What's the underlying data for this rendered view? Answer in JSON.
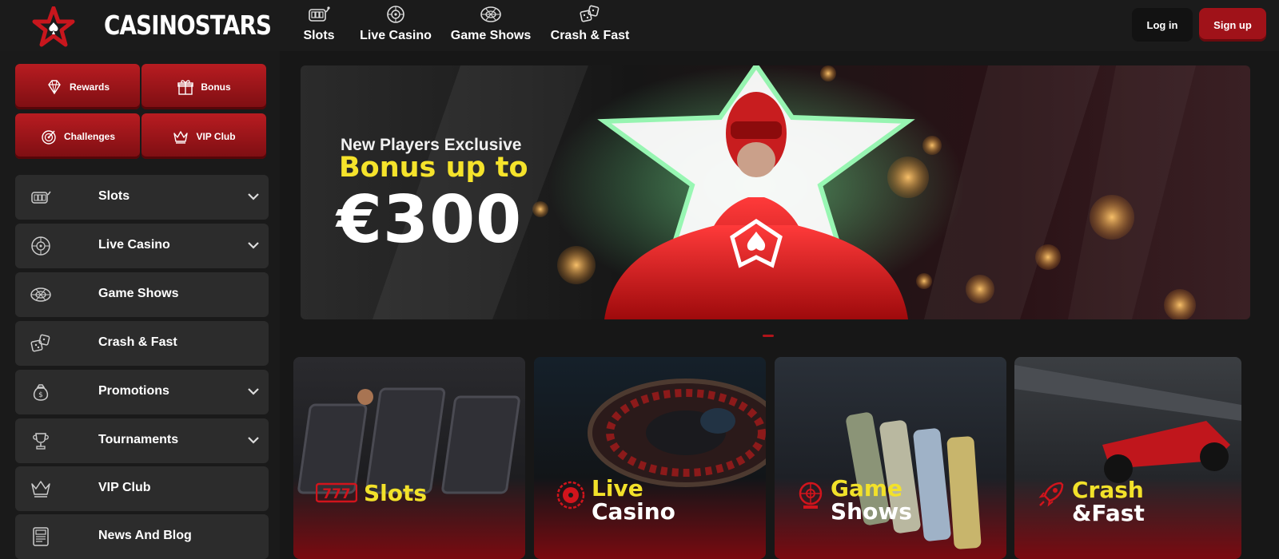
{
  "brand": {
    "name": "CASINOSTARS"
  },
  "topnav": [
    {
      "label": "Slots",
      "icon": "slot-machine-icon"
    },
    {
      "label": "Live Casino",
      "icon": "roulette-icon"
    },
    {
      "label": "Game Shows",
      "icon": "wheel-icon"
    },
    {
      "label": "Crash & Fast",
      "icon": "dice-icon"
    }
  ],
  "auth": {
    "login_label": "Log in",
    "signup_label": "Sign up"
  },
  "quick_links": [
    {
      "label": "Rewards",
      "icon": "diamond-icon"
    },
    {
      "label": "Bonus",
      "icon": "gift-icon"
    },
    {
      "label": "Challenges",
      "icon": "target-icon"
    },
    {
      "label": "VIP Club",
      "icon": "crown-icon"
    }
  ],
  "sidebar": {
    "items": [
      {
        "label": "Slots",
        "icon": "slot-machine-icon",
        "expandable": true
      },
      {
        "label": "Live Casino",
        "icon": "roulette-icon",
        "expandable": true
      },
      {
        "label": "Game Shows",
        "icon": "wheel-icon",
        "expandable": false
      },
      {
        "label": "Crash & Fast",
        "icon": "dice-icon",
        "expandable": false
      },
      {
        "label": "Promotions",
        "icon": "money-bag-icon",
        "expandable": true
      },
      {
        "label": "Tournaments",
        "icon": "trophy-icon",
        "expandable": true
      },
      {
        "label": "VIP Club",
        "icon": "crown-icon",
        "expandable": false
      },
      {
        "label": "News And Blog",
        "icon": "news-icon",
        "expandable": false
      }
    ]
  },
  "banner": {
    "line1": "New Players Exclusive",
    "line2": "Bonus up to",
    "amount": "€300"
  },
  "categories": [
    {
      "icon": "777-icon",
      "title": "Slots"
    },
    {
      "icon": "roulette-icon",
      "title_yellow": "Live",
      "title_white": "Casino"
    },
    {
      "icon": "wheel-icon",
      "title_yellow": "Game",
      "title_white": "Shows"
    },
    {
      "icon": "rocket-icon",
      "title_yellow": "Crash",
      "title_white": "&Fast"
    }
  ],
  "colors": {
    "accent_red": "#a01219",
    "highlight_yellow": "#f2e12a",
    "background": "#171717",
    "panel": "#2c2c2c"
  }
}
